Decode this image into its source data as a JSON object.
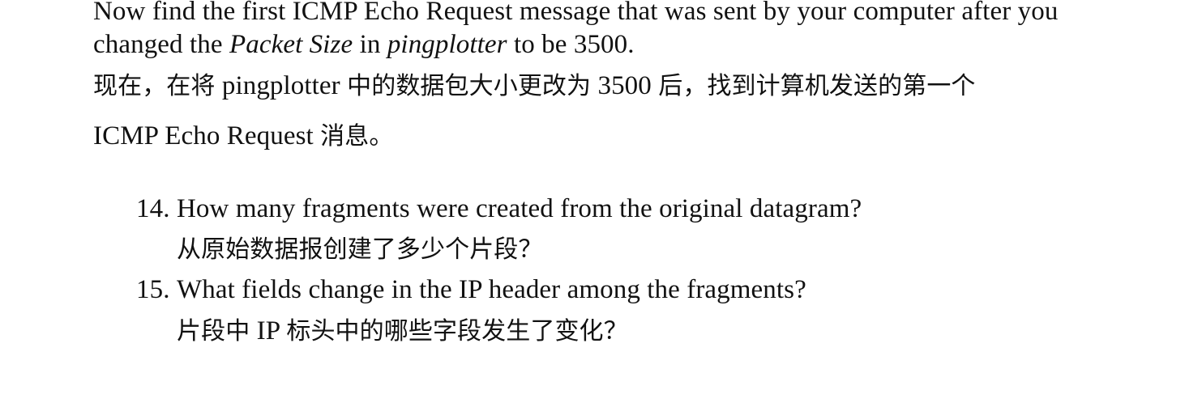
{
  "paragraph_en": {
    "line1": "Now find the first ICMP Echo Request message that was sent by your computer after you",
    "line2_prefix": "changed the ",
    "line2_italic1": "Packet Size",
    "line2_mid": " in ",
    "line2_italic2": "pingplotter",
    "line2_suffix": " to be 3500."
  },
  "paragraph_zh": {
    "line1_a": "现在，在将",
    "line1_b": " pingplotter ",
    "line1_c": "中的数据包大小更改为",
    "line1_d": " 3500 ",
    "line1_e": "后，找到计算机发送的第一个",
    "line2_a": "ICMP Echo Request ",
    "line2_b": "消息。"
  },
  "questions": [
    {
      "number": "14.",
      "en": "How many fragments were created from the original datagram?",
      "zh": "从原始数据报创建了多少个片段？"
    },
    {
      "number": "15.",
      "en": "What fields change in the IP header among the fragments?",
      "zh_a": "片段中",
      "zh_b": " IP ",
      "zh_c": "标头中的哪些字段发生了变化？"
    }
  ]
}
